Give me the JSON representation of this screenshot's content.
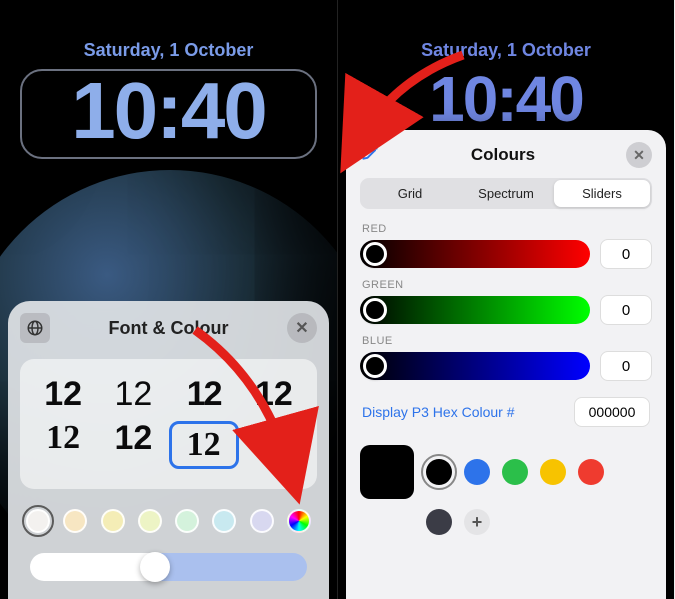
{
  "left": {
    "date": "Saturday, 1 October",
    "time": "10:40",
    "sheet_title": "Font & Colour",
    "fonts": [
      "12",
      "12",
      "12",
      "12",
      "12",
      "12",
      "12",
      "12"
    ],
    "swatches": [
      "#f3f1ef",
      "#f7e6c2",
      "#f4edb6",
      "#edf4c5",
      "#d4f2dc",
      "#c8e9f0",
      "#d8d8f0"
    ],
    "selected_swatch_index": 0
  },
  "right": {
    "date": "Saturday, 1 October",
    "time": "10:40",
    "sheet_title": "Colours",
    "segments": {
      "grid": "Grid",
      "spectrum": "Spectrum",
      "sliders": "Sliders"
    },
    "red": {
      "label": "RED",
      "value": "0"
    },
    "green": {
      "label": "GREEN",
      "value": "0"
    },
    "blue": {
      "label": "BLUE",
      "value": "0"
    },
    "hex_label": "Display P3 Hex Colour #",
    "hex_value": "000000",
    "presets": {
      "black": "#000000",
      "blue": "#2d73ea",
      "green": "#2bbf4a",
      "yellow": "#f7c300",
      "red": "#ef3b2f",
      "dark": "#3b3c46"
    }
  }
}
